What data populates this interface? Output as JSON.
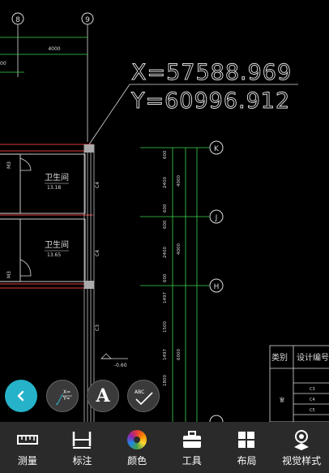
{
  "drawing": {
    "coord_x": "X=57588.969",
    "coord_y": "Y=60996.912",
    "grid_labels": [
      "8",
      "9",
      "K",
      "J",
      "H"
    ],
    "top_dimension": "4000",
    "left_dimension_fragment": "00",
    "rooms": [
      {
        "name": "卫生间",
        "area": "13.18"
      },
      {
        "name": "卫生间",
        "area": "13.65"
      }
    ],
    "door_tags": [
      "M3",
      "M3"
    ],
    "window_tags": [
      "C4",
      "C4",
      "C3"
    ],
    "level_mark": "-0.60",
    "vertical_dims_a": [
      "600",
      "2400",
      "600",
      "600",
      "2400",
      "600",
      "1497",
      "1500",
      "1497",
      "1800"
    ],
    "vertical_dims_b": [
      "4000",
      "4000",
      "6000"
    ],
    "table": {
      "header_category": "类别",
      "header_code": "设计编号",
      "row_category": "窗",
      "codes": [
        "C3",
        "C4",
        "C5"
      ]
    }
  },
  "fabs": {
    "back": "back-icon",
    "coord_icon_x": "X=",
    "coord_icon_y": "Y=",
    "text_icon": "A",
    "check_icon": "ABC"
  },
  "toolbar": {
    "items": [
      {
        "label": "测量",
        "icon": "ruler-icon"
      },
      {
        "label": "标注",
        "icon": "dimension-icon"
      },
      {
        "label": "颜色",
        "icon": "color-wheel-icon"
      },
      {
        "label": "工具",
        "icon": "toolbox-icon"
      },
      {
        "label": "布局",
        "icon": "layout-icon"
      },
      {
        "label": "视觉样式",
        "icon": "visual-style-icon"
      }
    ]
  },
  "colors": {
    "background": "#000000",
    "toolbar": "#2a2a2a",
    "accent": "#26b3c9",
    "cad_green": "#3dd64a",
    "cad_red": "#e03a3a",
    "cad_white": "#e6e6e6"
  }
}
